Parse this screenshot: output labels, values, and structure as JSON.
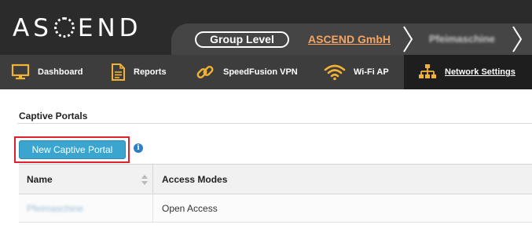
{
  "header": {
    "brand": "ASCEND",
    "group_level": "Group Level",
    "organization": "ASCEND GmbH",
    "device": "Pfeimaschine"
  },
  "nav": {
    "items": [
      {
        "label": "Dashboard",
        "icon": "monitor-icon"
      },
      {
        "label": "Reports",
        "icon": "document-icon"
      },
      {
        "label": "SpeedFusion VPN",
        "icon": "chain-link-icon"
      },
      {
        "label": "Wi-Fi AP",
        "icon": "wifi-icon"
      },
      {
        "label": "Network Settings",
        "icon": "network-tree-icon",
        "active": true
      }
    ]
  },
  "section": {
    "title": "Captive Portals",
    "new_button": "New Captive Portal"
  },
  "table": {
    "columns": [
      "Name",
      "Access Modes"
    ],
    "rows": [
      {
        "name": "Pfeimaschine",
        "access_modes": "Open Access"
      }
    ]
  },
  "colors": {
    "accent_orange": "#f5a461",
    "nav_icon_gold": "#f2b233",
    "primary_button": "#3aa5cf",
    "highlight_red": "#e0202a"
  }
}
